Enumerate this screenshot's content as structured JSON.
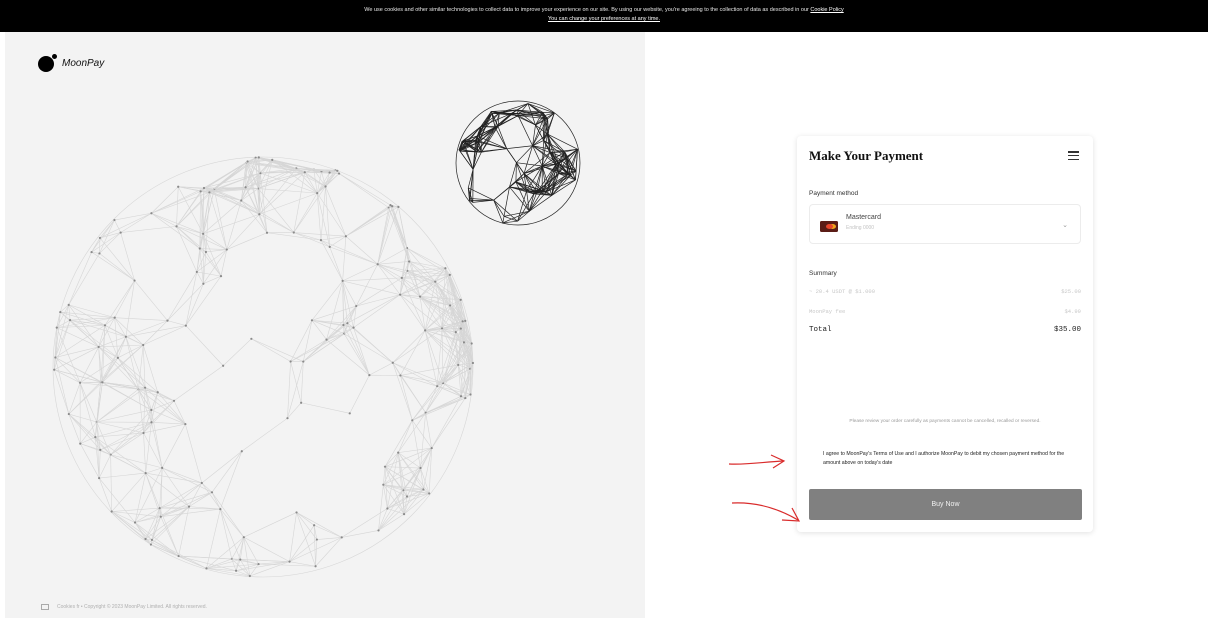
{
  "cookie_banner": {
    "line1": "We use cookies and other similar technologies to collect data to improve your experience on our site. By using our website, you're agreeing to the collection of data as described in our",
    "policy_link": "Cookie Policy",
    "line2": "You can change your preferences at any time."
  },
  "brand": {
    "name": "MoonPay"
  },
  "footer": {
    "text": "Cookies fr • Copyright © 2023 MoonPay Limited. All rights reserved."
  },
  "payment": {
    "title": "Make Your Payment",
    "method_label": "Payment method",
    "method_name": "Mastercard",
    "method_sub": "Ending 0000",
    "summary_label": "Summary",
    "rows": [
      {
        "label": "~ 20.4 USDT @ $1.000",
        "value": "$25.00"
      },
      {
        "label": "MoonPay fee",
        "value": "$4.99"
      },
      {
        "label": "Total",
        "value": "$35.00"
      }
    ],
    "note": "Please review your order carefully as payments cannot be cancelled, recalled or reversed.",
    "agreement": "I agree to MoonPay's Terms of Use and I authorize MoonPay to debit my chosen payment method for the amount above on today's date",
    "buy_label": "Buy Now"
  },
  "colors": {
    "button_bg": "#808080",
    "annotation_red": "#d92b2b",
    "left_panel_bg": "#f3f3f3"
  }
}
